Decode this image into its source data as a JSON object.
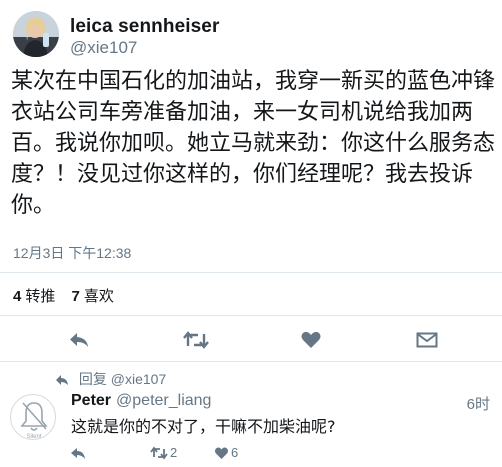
{
  "tweet": {
    "display_name": "leica sennheiser",
    "handle": "@xie107",
    "text": "某次在中国石化的加油站，我穿一新买的蓝色冲锋衣站公司车旁准备加油，来一女司机说给我加两百。我说你加呗。她立马就来劲：你这什么服务态度？！没见过你这样的，你们经理呢？我去投诉你。",
    "timestamp": "12月3日 下午12:38",
    "retweet_count": "4",
    "retweet_label": "转推",
    "like_count": "7",
    "like_label": "喜欢"
  },
  "reply": {
    "context_label": "回复",
    "context_handle": "@xie107",
    "avatar_label": "Silent",
    "display_name": "Peter",
    "handle": "@peter_liang",
    "time": "6时",
    "text": "这就是你的不对了，干嘛不加柴油呢?",
    "retweet_count": "2",
    "like_count": "6"
  },
  "colors": {
    "text": "#14171a",
    "secondary": "#657786",
    "divider": "#e1e8ed"
  },
  "icons": {
    "reply": "reply-arrow-icon",
    "retweet": "retweet-icon",
    "like": "heart-icon",
    "message": "envelope-icon",
    "silent": "bell-slash-icon"
  }
}
